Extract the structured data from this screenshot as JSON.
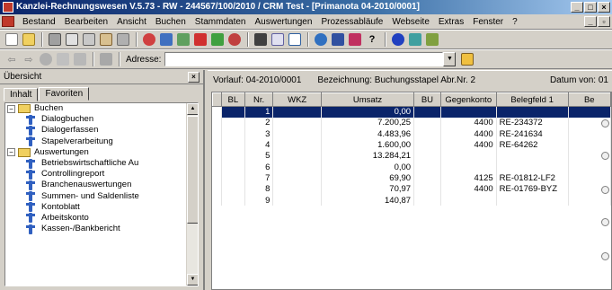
{
  "window": {
    "title": "Kanzlei-Rechnungswesen V.5.73 - RW - 244567/100/2010 / CRM Test - [Primanota 04-2010/0001]"
  },
  "menu": {
    "items": [
      "Bestand",
      "Bearbeiten",
      "Ansicht",
      "Buchen",
      "Stammdaten",
      "Auswertungen",
      "Prozessabläufe",
      "Webseite",
      "Extras",
      "Fenster",
      "?"
    ]
  },
  "address": {
    "label": "Adresse:",
    "value": ""
  },
  "leftpane": {
    "title": "Übersicht",
    "tabs": [
      "Inhalt",
      "Favoriten"
    ],
    "tree": [
      {
        "type": "folder",
        "label": "Buchen",
        "expander": "−"
      },
      {
        "type": "item",
        "label": "Dialogbuchen"
      },
      {
        "type": "item",
        "label": "Dialogerfassen"
      },
      {
        "type": "item",
        "label": "Stapelverarbeitung"
      },
      {
        "type": "folder",
        "label": "Auswertungen",
        "expander": "−"
      },
      {
        "type": "item",
        "label": "Betriebswirtschaftliche Au"
      },
      {
        "type": "item",
        "label": "Controllingreport"
      },
      {
        "type": "item",
        "label": "Branchenauswertungen"
      },
      {
        "type": "item",
        "label": "Summen- und Saldenliste"
      },
      {
        "type": "item",
        "label": "Kontoblatt"
      },
      {
        "type": "item",
        "label": "Arbeitskonto"
      },
      {
        "type": "item",
        "label": "Kassen-/Bankbericht"
      }
    ]
  },
  "info": {
    "vorlauf": "Vorlauf: 04-2010/0001",
    "bezeichnung": "Bezeichnung: Buchungsstapel Abr.Nr. 2",
    "datum": "Datum von: 01"
  },
  "grid": {
    "columns": [
      "BL",
      "Nr.",
      "WKZ",
      "Umsatz",
      "BU",
      "Gegenkonto",
      "Belegfeld 1",
      "Be"
    ],
    "rows": [
      {
        "bl": "",
        "nr": "1",
        "wkz": "",
        "umsatz": "0,00",
        "bu": "",
        "gegenkonto": "",
        "beleg": "",
        "be": ""
      },
      {
        "bl": "",
        "nr": "2",
        "wkz": "",
        "umsatz": "7.200,25",
        "bu": "",
        "gegenkonto": "4400",
        "beleg": "RE-234372",
        "be": ""
      },
      {
        "bl": "",
        "nr": "3",
        "wkz": "",
        "umsatz": "4.483,96",
        "bu": "",
        "gegenkonto": "4400",
        "beleg": "RE-241634",
        "be": ""
      },
      {
        "bl": "",
        "nr": "4",
        "wkz": "",
        "umsatz": "1.600,00",
        "bu": "",
        "gegenkonto": "4400",
        "beleg": "RE-64262",
        "be": ""
      },
      {
        "bl": "",
        "nr": "5",
        "wkz": "",
        "umsatz": "13.284,21",
        "bu": "",
        "gegenkonto": "",
        "beleg": "",
        "be": ""
      },
      {
        "bl": "",
        "nr": "6",
        "wkz": "",
        "umsatz": "0,00",
        "bu": "",
        "gegenkonto": "",
        "beleg": "",
        "be": ""
      },
      {
        "bl": "",
        "nr": "7",
        "wkz": "",
        "umsatz": "69,90",
        "bu": "",
        "gegenkonto": "4125",
        "beleg": "RE-01812-LF2",
        "be": ""
      },
      {
        "bl": "",
        "nr": "8",
        "wkz": "",
        "umsatz": "70,97",
        "bu": "",
        "gegenkonto": "4400",
        "beleg": "RE-01769-BYZ",
        "be": ""
      },
      {
        "bl": "",
        "nr": "9",
        "wkz": "",
        "umsatz": "140,87",
        "bu": "",
        "gegenkonto": "",
        "beleg": "",
        "be": ""
      }
    ]
  }
}
